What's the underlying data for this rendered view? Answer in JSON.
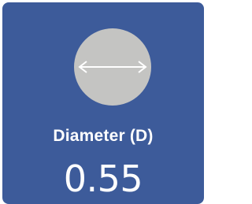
{
  "tile": {
    "label": "Diameter (D)",
    "value": "0.55",
    "icon": "diameter-circle-icon",
    "colors": {
      "background": "#3d5b9a",
      "circle": "#c4c4c2",
      "text": "#ffffff",
      "arrow": "#ffffff"
    }
  }
}
